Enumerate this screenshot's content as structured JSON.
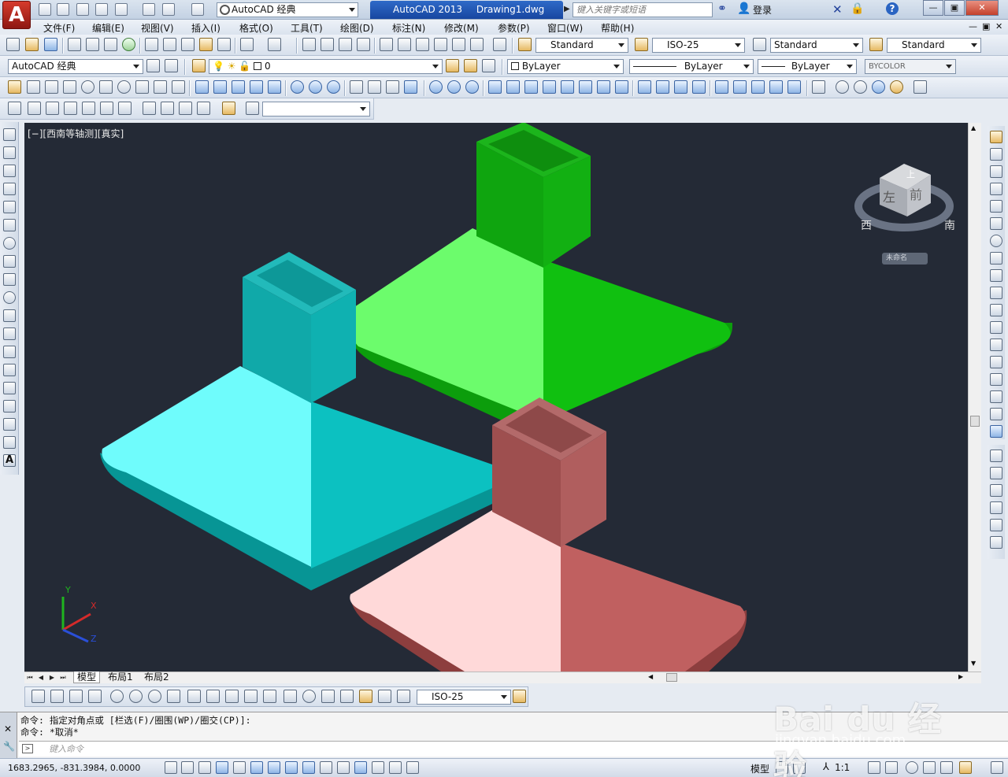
{
  "app": {
    "logo_letter": "A",
    "workspace": "AutoCAD 经典",
    "product": "AutoCAD 2013",
    "document": "Drawing1.dwg",
    "search_placeholder": "键入关键字或短语",
    "login": "登录"
  },
  "menu": [
    "文件(F)",
    "编辑(E)",
    "视图(V)",
    "插入(I)",
    "格式(O)",
    "工具(T)",
    "绘图(D)",
    "标注(N)",
    "修改(M)",
    "参数(P)",
    "窗口(W)",
    "帮助(H)"
  ],
  "styles": {
    "text_style": "Standard",
    "dim_style": "ISO-25",
    "table_style": "Standard",
    "multileader_style": "Standard"
  },
  "workspace_combo": "AutoCAD 经典",
  "layer": "0",
  "properties": {
    "color": "ByLayer",
    "linetype": "ByLayer",
    "lineweight": "ByLayer",
    "plotstyle": "BYCOLOR"
  },
  "viewport": {
    "label": "[−][西南等轴测][真实]",
    "background": "#242a36",
    "viewcube": {
      "top": "上",
      "left": "左",
      "front": "前",
      "west": "西",
      "south": "南",
      "label": "未命名"
    },
    "ucs": {
      "x": "X",
      "y": "Y",
      "z": "Z"
    },
    "solids": [
      {
        "name": "green-solid",
        "light": "#6cfc6c",
        "dark": "#10c010",
        "shade": "#0d9d0d"
      },
      {
        "name": "cyan-solid",
        "light": "#6ffcfc",
        "dark": "#0cc1c1",
        "shade": "#099a9a"
      },
      {
        "name": "pink-solid",
        "light": "#ffd9d9",
        "dark": "#c06060",
        "shade": "#944444"
      }
    ]
  },
  "layout_tabs": [
    "模型",
    "布局1",
    "布局2"
  ],
  "dim_toolbar_style": "ISO-25",
  "command": {
    "history": [
      "命令: 指定对角点或 [栏选(F)/圈围(WP)/圈交(CP)]:",
      "命令: *取消*"
    ],
    "placeholder": "键入命令"
  },
  "status": {
    "coords": "1683.2965,  -831.3984,  0.0000",
    "space": "模型",
    "scale": "1:1"
  },
  "watermark": {
    "brand": "Bai du 经验",
    "url": "jingyan.baidu.com"
  }
}
